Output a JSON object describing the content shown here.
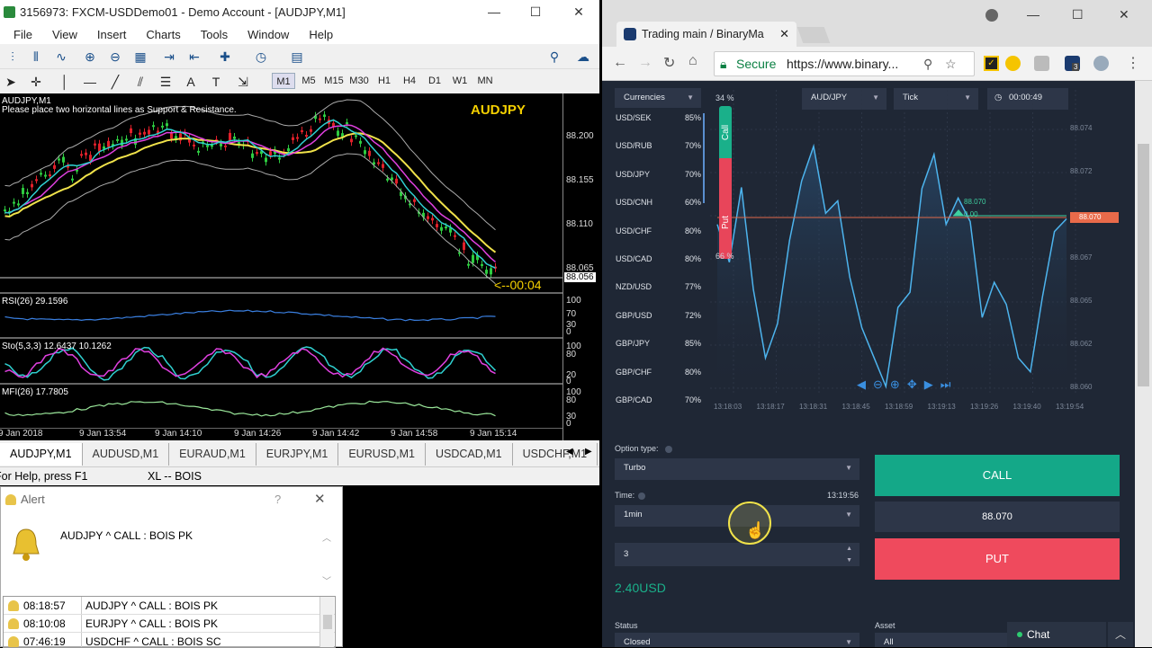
{
  "mt4": {
    "title": "3156973: FXCM-USDDemo01 - Demo Account - [AUDJPY,M1]",
    "menu": [
      "File",
      "View",
      "Insert",
      "Charts",
      "Tools",
      "Window",
      "Help"
    ],
    "timeframes": [
      "M1",
      "M5",
      "M15",
      "M30",
      "H1",
      "H4",
      "D1",
      "W1",
      "MN"
    ],
    "chart_header": "AUDJPY,M1",
    "chart_note": "Please place two horizontal lines as Support & Resistance.",
    "symbol": "AUDJPY",
    "countdown": "<--00:04",
    "price_ticks": [
      "88.200",
      "88.155",
      "88.110",
      "88.065",
      "88.056"
    ],
    "rsi_label": "RSI(26) 29.1596",
    "sto_label": "Sto(5,3,3) 12.6437 10.1262",
    "mfi_label": "MFI(26) 17.7805",
    "rsi_ticks": [
      "100",
      "70",
      "30",
      "0"
    ],
    "sto_ticks": [
      "100",
      "80",
      "20",
      "0"
    ],
    "mfi_ticks": [
      "100",
      "80",
      "30",
      "0"
    ],
    "time_ticks": [
      "9 Jan 2018",
      "9 Jan 13:54",
      "9 Jan 14:10",
      "9 Jan 14:26",
      "9 Jan 14:42",
      "9 Jan 14:58",
      "9 Jan 15:14"
    ],
    "tabs": [
      "AUDJPY,M1",
      "AUDUSD,M1",
      "EURAUD,M1",
      "EURJPY,M1",
      "EURUSD,M1",
      "USDCAD,M1",
      "USDCHF,M1"
    ],
    "status_help": "For Help, press F1",
    "status_profile": "XL -- BOIS"
  },
  "alert": {
    "title": "Alert",
    "help": "?",
    "message": "AUDJPY ^ CALL : BOIS PK",
    "rows": [
      {
        "time": "08:18:57",
        "msg": "AUDJPY ^ CALL : BOIS PK"
      },
      {
        "time": "08:10:08",
        "msg": "EURJPY ^ CALL : BOIS PK"
      },
      {
        "time": "07:46:19",
        "msg": "USDCHF ^ CALL : BOIS SC"
      }
    ]
  },
  "browser": {
    "tab_title": "Trading main / BinaryMa",
    "secure": "Secure",
    "url": "https://www.binary...",
    "ext_badge": "3",
    "currencies_label": "Currencies",
    "currencies": [
      {
        "pair": "USD/SEK",
        "pct": "85%"
      },
      {
        "pair": "USD/RUB",
        "pct": "70%"
      },
      {
        "pair": "USD/JPY",
        "pct": "70%"
      },
      {
        "pair": "USD/CNH",
        "pct": "60%"
      },
      {
        "pair": "USD/CHF",
        "pct": "80%"
      },
      {
        "pair": "USD/CAD",
        "pct": "80%"
      },
      {
        "pair": "NZD/USD",
        "pct": "77%"
      },
      {
        "pair": "GBP/USD",
        "pct": "72%"
      },
      {
        "pair": "GBP/JPY",
        "pct": "85%"
      },
      {
        "pair": "GBP/CHF",
        "pct": "80%"
      },
      {
        "pair": "GBP/CAD",
        "pct": "70%"
      }
    ],
    "asset": "AUD/JPY",
    "chart_mode": "Tick",
    "timer": "00:00:49",
    "call_pct": "34 %",
    "put_pct": "66 %",
    "call_label": "Call",
    "put_label": "Put",
    "price_ticks": [
      "88.074",
      "88.072",
      "88.070",
      "88.067",
      "88.065",
      "88.062",
      "88.060"
    ],
    "current_price": "88.070",
    "strike_label": "88.070",
    "strike_sub": "0.00",
    "time_ticks": [
      "13:18:03",
      "13:18:17",
      "13:18:31",
      "13:18:45",
      "13:18:59",
      "13:19:13",
      "13:19:26",
      "13:19:40",
      "13:19:54"
    ],
    "option_type_label": "Option type:",
    "option_type": "Turbo",
    "time_label": "Time:",
    "time_now": "13:19:56",
    "time_value": "1min",
    "amount": "3",
    "payout": "2.40USD",
    "call_btn": "CALL",
    "price_box": "88.070",
    "put_btn": "PUT",
    "status_label": "Status",
    "status_value": "Closed",
    "asset_label": "Asset",
    "asset_value": "All",
    "chat": "Chat"
  }
}
